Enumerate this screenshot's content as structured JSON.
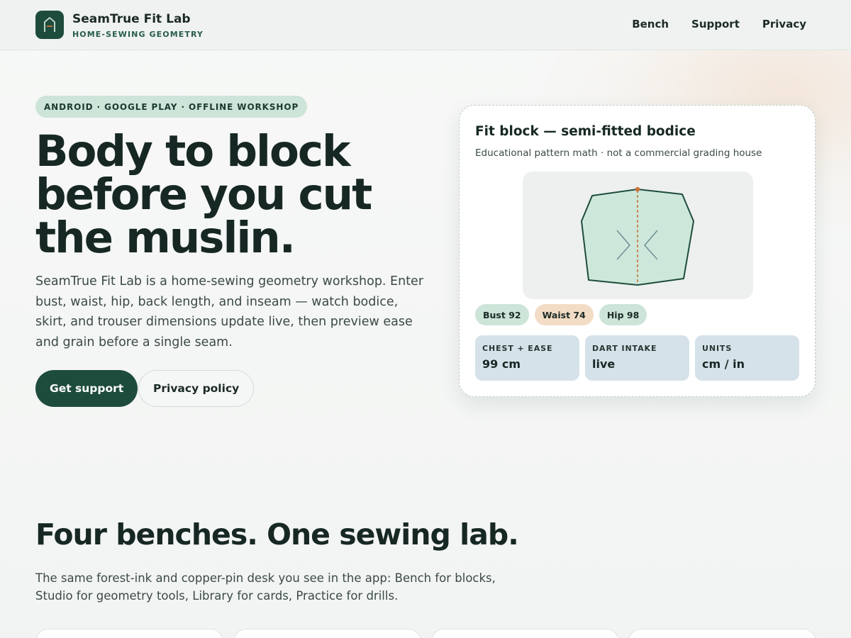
{
  "header": {
    "brand_name": "SeamTrue Fit Lab",
    "brand_tagline": "HOME-SEWING GEOMETRY",
    "nav": [
      {
        "label": "Bench"
      },
      {
        "label": "Support"
      },
      {
        "label": "Privacy"
      }
    ]
  },
  "hero": {
    "badge": "ANDROID · GOOGLE PLAY · OFFLINE WORKSHOP",
    "headline_lines": [
      "Body to block",
      "before you cut",
      "the muslin."
    ],
    "lede": "SeamTrue Fit Lab is a home-sewing geometry workshop. Enter bust, waist, hip, back length, and inseam — watch bodice, skirt, and trouser dimensions update live, then preview ease and grain before a single seam.",
    "primary_button": "Get support",
    "secondary_button": "Privacy policy"
  },
  "fit_card": {
    "title": "Fit block — semi-fitted bodice",
    "subtitle": "Educational pattern math · not a commercial grading house",
    "chips": [
      {
        "label": "Bust 92",
        "tone": "green"
      },
      {
        "label": "Waist 74",
        "tone": "peach"
      },
      {
        "label": "Hip 98",
        "tone": "green"
      }
    ],
    "stats": [
      {
        "label": "CHEST + EASE",
        "value": "99 cm"
      },
      {
        "label": "DART INTAKE",
        "value": "live"
      },
      {
        "label": "UNITS",
        "value": "cm / in"
      }
    ]
  },
  "benches_section": {
    "title": "Four benches. One sewing lab.",
    "lede": "The same forest-ink and copper-pin desk you see in the app: Bench for blocks, Studio for geometry tools, Library for cards, Practice for drills."
  },
  "colors": {
    "forest_ink": "#1e4c3c",
    "copper_pin": "#c8733a",
    "mint": "#cde4d9",
    "peach": "#f3dcc5",
    "stat_blue": "#d5e2e9"
  },
  "icons": {
    "logo": "house-pattern-icon",
    "block": "bodice-block-icon"
  }
}
